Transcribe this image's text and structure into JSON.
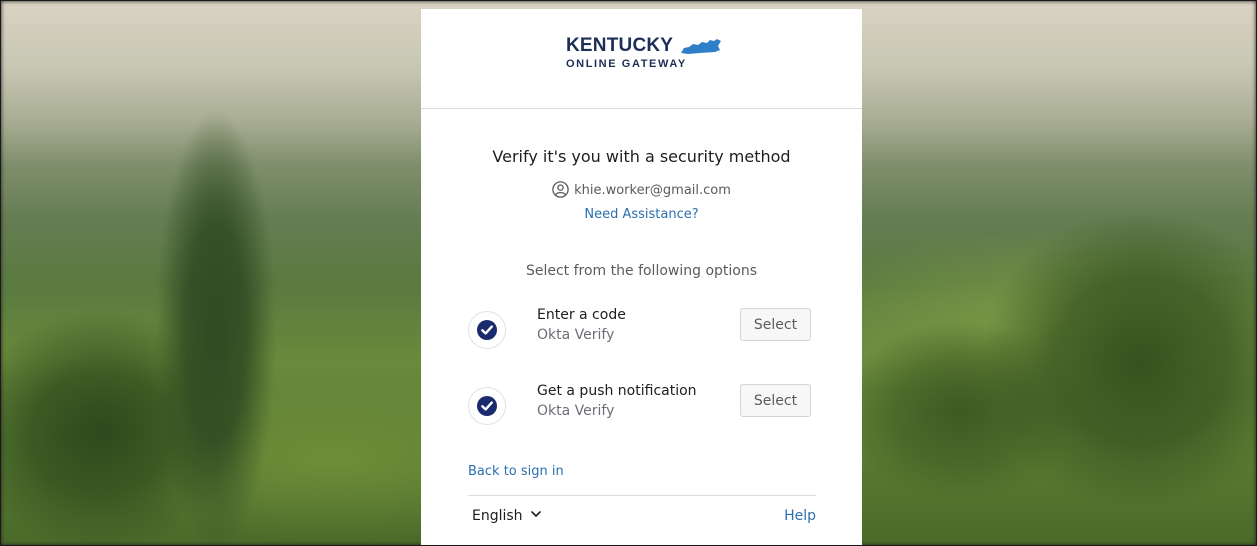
{
  "branding": {
    "logo_line1": "KENTUCKY",
    "logo_line2": "ONLINE GATEWAY",
    "brand_color": "#1d2f56",
    "state_color": "#2e7fc8"
  },
  "header": {
    "title": "Verify it's you with a security method",
    "identifier": "khie.worker@gmail.com",
    "identifier_icon": "user-icon",
    "help_link": "Need Assistance?"
  },
  "options": {
    "subtitle": "Select from the following options",
    "items": [
      {
        "label": "Enter a code",
        "provider": "Okta Verify",
        "icon": "okta-verify-icon",
        "button": "Select"
      },
      {
        "label": "Get a push notification",
        "provider": "Okta Verify",
        "icon": "okta-verify-icon",
        "button": "Select"
      }
    ]
  },
  "footer": {
    "back_link": "Back to sign in",
    "language": "English",
    "help": "Help"
  },
  "colors": {
    "link": "#2a6fb0",
    "text": "#1d1d21",
    "muted": "#6e6e78",
    "okta_icon": "#1a2a6c"
  }
}
